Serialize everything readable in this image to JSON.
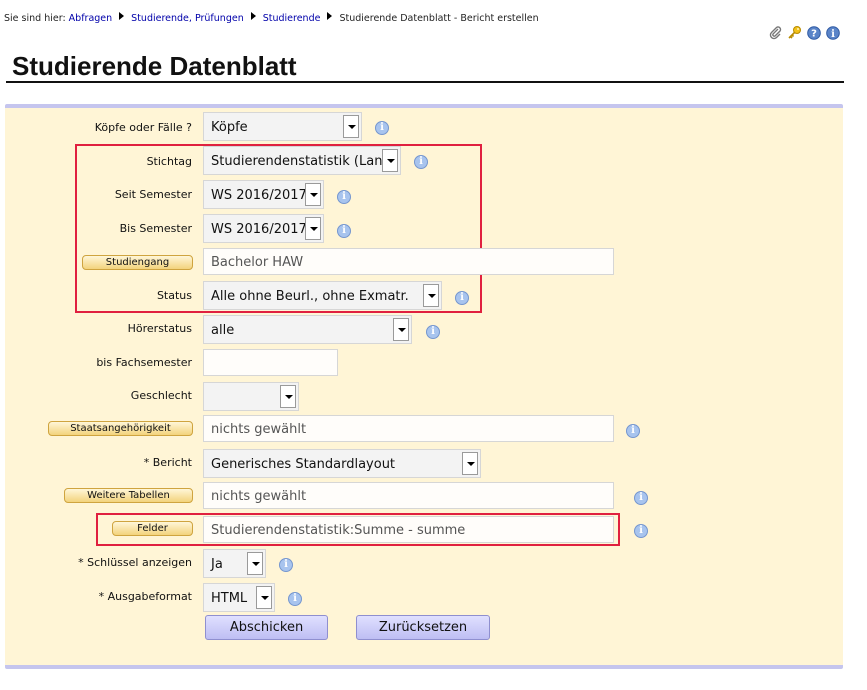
{
  "breadcrumb": {
    "prefix": "Sie sind hier:",
    "items": [
      "Abfragen",
      "Studierende, Prüfungen",
      "Studierende"
    ],
    "current": "Studierende Datenblatt - Bericht erstellen"
  },
  "toolbar_icons": [
    "paperclip-icon",
    "key-icon",
    "help-icon",
    "info-icon"
  ],
  "page_title": "Studierende Datenblatt",
  "form": {
    "koepfe": {
      "label": "Köpfe oder Fälle ?",
      "value": "Köpfe"
    },
    "stichtag": {
      "label": "Stichtag",
      "value": "Studierendenstatistik (Land)"
    },
    "seit_semester": {
      "label": "Seit Semester",
      "value": "WS 2016/2017"
    },
    "bis_semester": {
      "label": "Bis Semester",
      "value": "WS 2016/2017"
    },
    "studiengang": {
      "button": "Studiengang",
      "value": "Bachelor HAW"
    },
    "status": {
      "label": "Status",
      "value": "Alle ohne Beurl., ohne Exmatr."
    },
    "hoererstatus": {
      "label": "Hörerstatus",
      "value": "alle"
    },
    "bis_fachsemester": {
      "label": "bis Fachsemester",
      "value": ""
    },
    "geschlecht": {
      "label": "Geschlecht",
      "value": ""
    },
    "staatsangehoerigkeit": {
      "button": "Staatsangehörigkeit",
      "value": "nichts gewählt"
    },
    "bericht": {
      "label": "* Bericht",
      "value": "Generisches Standardlayout"
    },
    "weitere_tabellen": {
      "button": "Weitere Tabellen",
      "value": "nichts gewählt"
    },
    "felder": {
      "button": "Felder",
      "value": "Studierendenstatistik:Summe - summe"
    },
    "schluessel": {
      "label": "* Schlüssel anzeigen",
      "value": "Ja"
    },
    "ausgabeformat": {
      "label": "* Ausgabeformat",
      "value": "HTML"
    }
  },
  "actions": {
    "submit": "Abschicken",
    "reset": "Zurücksetzen"
  },
  "colors": {
    "panel_bg": "#fff5d6",
    "panel_border": "#c5c5ee",
    "highlight": "#e0203f",
    "info": "#a8c4ee"
  }
}
